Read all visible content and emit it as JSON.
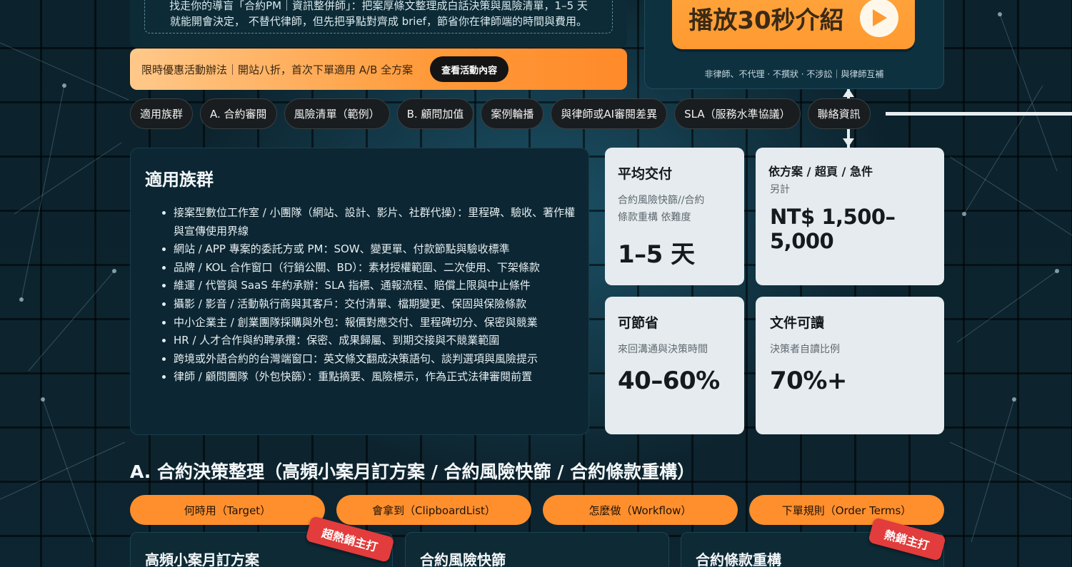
{
  "intro": {
    "line1": "找走你的導盲「合約PM｜資訊整併師」：把案厚條文整理成白話決策與風險清單，1–5 天",
    "line2": "就能開會決定， 不替代律師，但先把爭點對齊成 brief，節省你在律師端的時間與費用。"
  },
  "promo": {
    "text": "限時優惠活動辦法｜開站八折，首次下單適用 A/B 全方案",
    "button": "查看活動內容"
  },
  "video": {
    "button": "播放30秒介紹",
    "caption": "非律師、不代理 · 不撰狀 · 不涉訟｜與律師互補"
  },
  "nav": [
    "適用族群",
    "A. 合約審閱",
    "風險清單（範例）",
    "B. 顧問加值",
    "案例輪播",
    "與律師或AI審閱差異",
    "SLA（服務水準協議）",
    "聯絡資訊"
  ],
  "audience": {
    "title": "適用族群",
    "items": [
      "接案型數位工作室 / 小團隊（網站、設計、影片、社群代操）：里程碑、驗收、著作權與宣傳使用界線",
      "網站 / APP 專案的委託方或 PM：SOW、變更單、付款節點與驗收標準",
      "品牌 / KOL 合作窗口（行銷公關、BD）：素材授權範圍、二次使用、下架條款",
      "維運 / 代管與 SaaS 年約承辦：SLA 指標、通報流程、賠償上限與中止條件",
      "攝影 / 影音 / 活動執行商與其客戶：交付清單、檔期變更、保固與保險條款",
      "中小企業主 / 創業團隊採購與外包：報價對應交付、里程碑切分、保密與競業",
      "HR / 人才合作與約聘承攬：保密、成果歸屬、到期交接與不競業範圍",
      "跨境或外語合約的台灣端窗口：英文條文翻成決策語句、談判選項與風險提示",
      "律師 / 顧問團隊（外包快篩）：重點摘要、風險標示，作為正式法律審閱前置"
    ]
  },
  "stats": {
    "delivery": {
      "title": "平均交付",
      "sub1": "合約風險快篩//合約",
      "sub2": "條款重構 依難度",
      "value": "1–5 天"
    },
    "price": {
      "title": "依方案 / 超頁 / 急件",
      "sub": "另計",
      "value": "NT$ 1,500–5,000"
    },
    "save": {
      "title": "可節省",
      "sub": "來回溝通與決策時間",
      "value": "40–60%"
    },
    "readable": {
      "title": "文件可讀",
      "sub": "決策者自讀比例",
      "value": "70%+"
    }
  },
  "sectionA": {
    "title": "A. 合約決策整理（高頻小案月訂方案 / 合約風險快篩 / 合約條款重構）",
    "tabs": [
      "何時用（Target）",
      "會拿到（ClipboardList）",
      "怎麼做（Workflow）",
      "下單規則（Order Terms）"
    ],
    "plans": [
      {
        "title": "高頻小案月訂方案",
        "ribbon": "超熱銷主打"
      },
      {
        "title": "合約風險快篩",
        "ribbon": ""
      },
      {
        "title": "合約條款重構",
        "ribbon": "熱銷主打"
      }
    ]
  }
}
